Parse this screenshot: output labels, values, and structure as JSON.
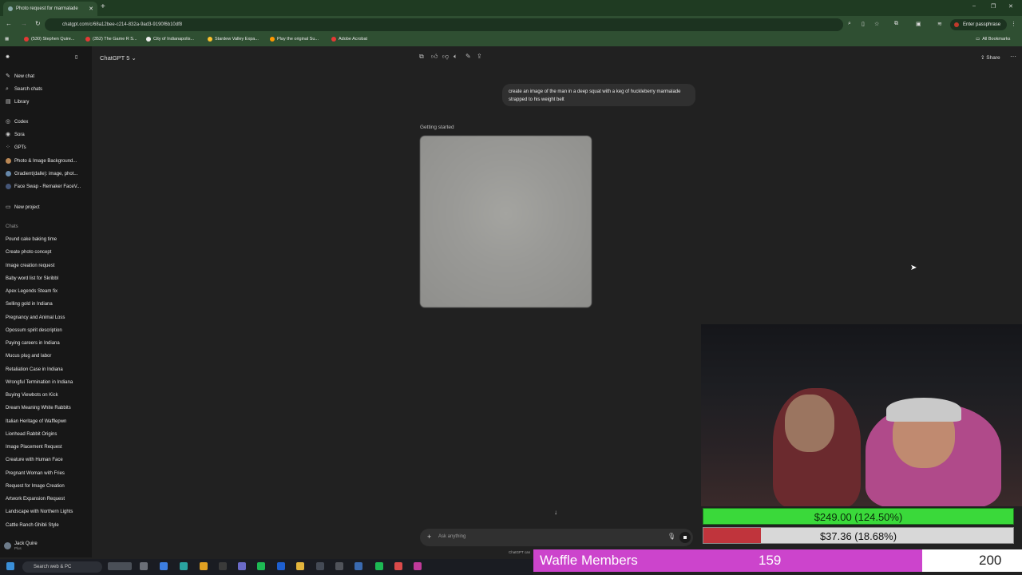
{
  "browser": {
    "tab_title": "Photo request for marmalade",
    "url": "chatgpt.com/c/68a12bee-c214-832a-9ad3-9190f6b10df8",
    "passphrase_button": "Enter passphrase",
    "all_bookmarks": "All Bookmarks",
    "bookmarks": [
      {
        "label": "(530) Stephen Quire...",
        "color": "#e53935"
      },
      {
        "label": "(352) The Game R S...",
        "color": "#e53935"
      },
      {
        "label": "City of Indianapolis...",
        "color": "#eeeeee"
      },
      {
        "label": "Stardew Valley Expa...",
        "color": "#fbc02d"
      },
      {
        "label": "Play the original Su...",
        "color": "#ff9800"
      },
      {
        "label": "Adobe Acrobat",
        "color": "#e53935"
      }
    ]
  },
  "sidebar": {
    "top_items": [
      {
        "label": "New chat",
        "icon": "compose-icon"
      },
      {
        "label": "Search chats",
        "icon": "search-icon"
      },
      {
        "label": "Library",
        "icon": "library-icon"
      }
    ],
    "tool_items": [
      {
        "label": "Codex",
        "icon": "codex-icon"
      },
      {
        "label": "Sora",
        "icon": "sora-icon"
      },
      {
        "label": "GPTs",
        "icon": "grid-icon"
      },
      {
        "label": "Photo & Image Background...",
        "icon": "gpt-avatar-icon"
      },
      {
        "label": "Gradient(dalle): image, phot...",
        "icon": "gpt-avatar-icon"
      },
      {
        "label": "Face Swap - Remaker FaceV...",
        "icon": "gpt-avatar-icon"
      }
    ],
    "new_project": "New project",
    "chats_label": "Chats",
    "chats": [
      "Pound cake baking time",
      "Create photo concept",
      "Image creation request",
      "Baby word list for Skribbl",
      "Apex Legends Steam fix",
      "Selling gold in Indiana",
      "Pregnancy and Animal Loss",
      "Opossum spirit description",
      "Paying careers in Indiana",
      "Mucus plug and labor",
      "Retaliation Case in Indiana",
      "Wrongful Termination in Indiana",
      "Buying Viewbots on Kick",
      "Dream Meaning White Rabbits",
      "Italian Heritage of Wafflepwn",
      "Lionhead Rabbit Origins",
      "Image Placement Request",
      "Creature with Human Face",
      "Pregnant Woman with Fries",
      "Request for Image Creation",
      "Artwork Expansion Request",
      "Landscape with Northern Lights",
      "Cattle Ranch Ghibli Style"
    ],
    "user_name": "Jack Quire",
    "user_plan": "Plus"
  },
  "main": {
    "model_label": "ChatGPT 5",
    "share_label": "Share",
    "user_message": "create an image of the man in a deep squat with a keg of huckleberry marmalade strapped to his weight belt",
    "status": "Getting started",
    "composer_placeholder": "Ask anything",
    "disclaimer": "ChatGPT can"
  },
  "overlay": {
    "goal1_text": "$249.00 (124.50%)",
    "goal1_progress": 1.0,
    "goal2_text": "$37.36 (18.68%)",
    "goal2_progress": 0.1868,
    "members_label": "Waffle Members",
    "members_count": "159",
    "members_goal": "200",
    "members_progress": 0.795
  },
  "taskbar": {
    "search_placeholder": "Search web & PC"
  }
}
